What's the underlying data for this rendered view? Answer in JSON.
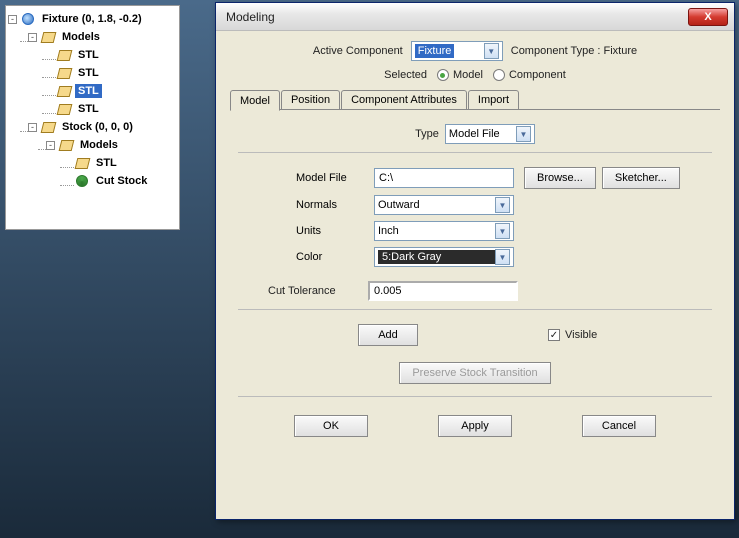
{
  "tree": {
    "fixture_label": "Fixture (0, 1.8, -0.2)",
    "models_label": "Models",
    "stl_label": "STL",
    "stock_label": "Stock (0, 0, 0)",
    "cutstock_label": "Cut Stock",
    "expander_minus": "-"
  },
  "dialog": {
    "title": "Modeling",
    "active_component_label": "Active Component",
    "active_component_value": "Fixture",
    "component_type_text": "Component Type : Fixture",
    "selected_label": "Selected",
    "radio_model": "Model",
    "radio_component": "Component",
    "tabs": {
      "model": "Model",
      "position": "Position",
      "attrs": "Component Attributes",
      "import": "Import"
    },
    "type_label": "Type",
    "type_value": "Model File",
    "model_file_label": "Model File",
    "model_file_value": "C:\\",
    "browse": "Browse...",
    "sketcher": "Sketcher...",
    "normals_label": "Normals",
    "normals_value": "Outward",
    "units_label": "Units",
    "units_value": "Inch",
    "color_label": "Color",
    "color_value": "5:Dark Gray",
    "cut_tol_label": "Cut  Tolerance",
    "cut_tol_value": "0.005",
    "add": "Add",
    "visible": "Visible",
    "preserve": "Preserve Stock Transition",
    "ok": "OK",
    "apply": "Apply",
    "cancel": "Cancel",
    "check_mark": "✓"
  }
}
